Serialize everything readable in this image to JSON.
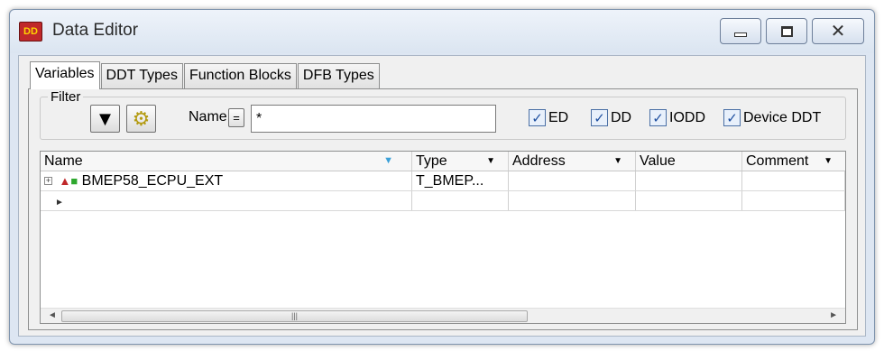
{
  "window": {
    "title": "Data Editor",
    "app_icon_text": "DD",
    "controls": {
      "minimize": "minimize",
      "maximize": "maximize",
      "close": "✕"
    }
  },
  "tabs": [
    {
      "label": "Variables",
      "active": true
    },
    {
      "label": "DDT Types",
      "active": false
    },
    {
      "label": "Function Blocks",
      "active": false
    },
    {
      "label": "DFB Types",
      "active": false
    }
  ],
  "filter": {
    "label": "Filter",
    "name_label": "Name",
    "operator": "=",
    "name_value": "*",
    "checkboxes": [
      {
        "label": "ED",
        "checked": true
      },
      {
        "label": "DD",
        "checked": true
      },
      {
        "label": "IODD",
        "checked": true
      },
      {
        "label": "Device DDT",
        "checked": true
      }
    ],
    "check_mark": "✓"
  },
  "grid": {
    "columns": [
      "Name",
      "Type",
      "Address",
      "Value",
      "Comment"
    ],
    "rows": [
      {
        "expander": "+",
        "name": "BMEP58_ECPU_EXT",
        "type": "T_BMEP...",
        "address": "",
        "value": "",
        "comment": ""
      }
    ],
    "new_row_marker": "►"
  },
  "colors": {
    "accent": "#3aa0d8",
    "check": "#1e4fa0",
    "app_icon": "#c0282a"
  }
}
